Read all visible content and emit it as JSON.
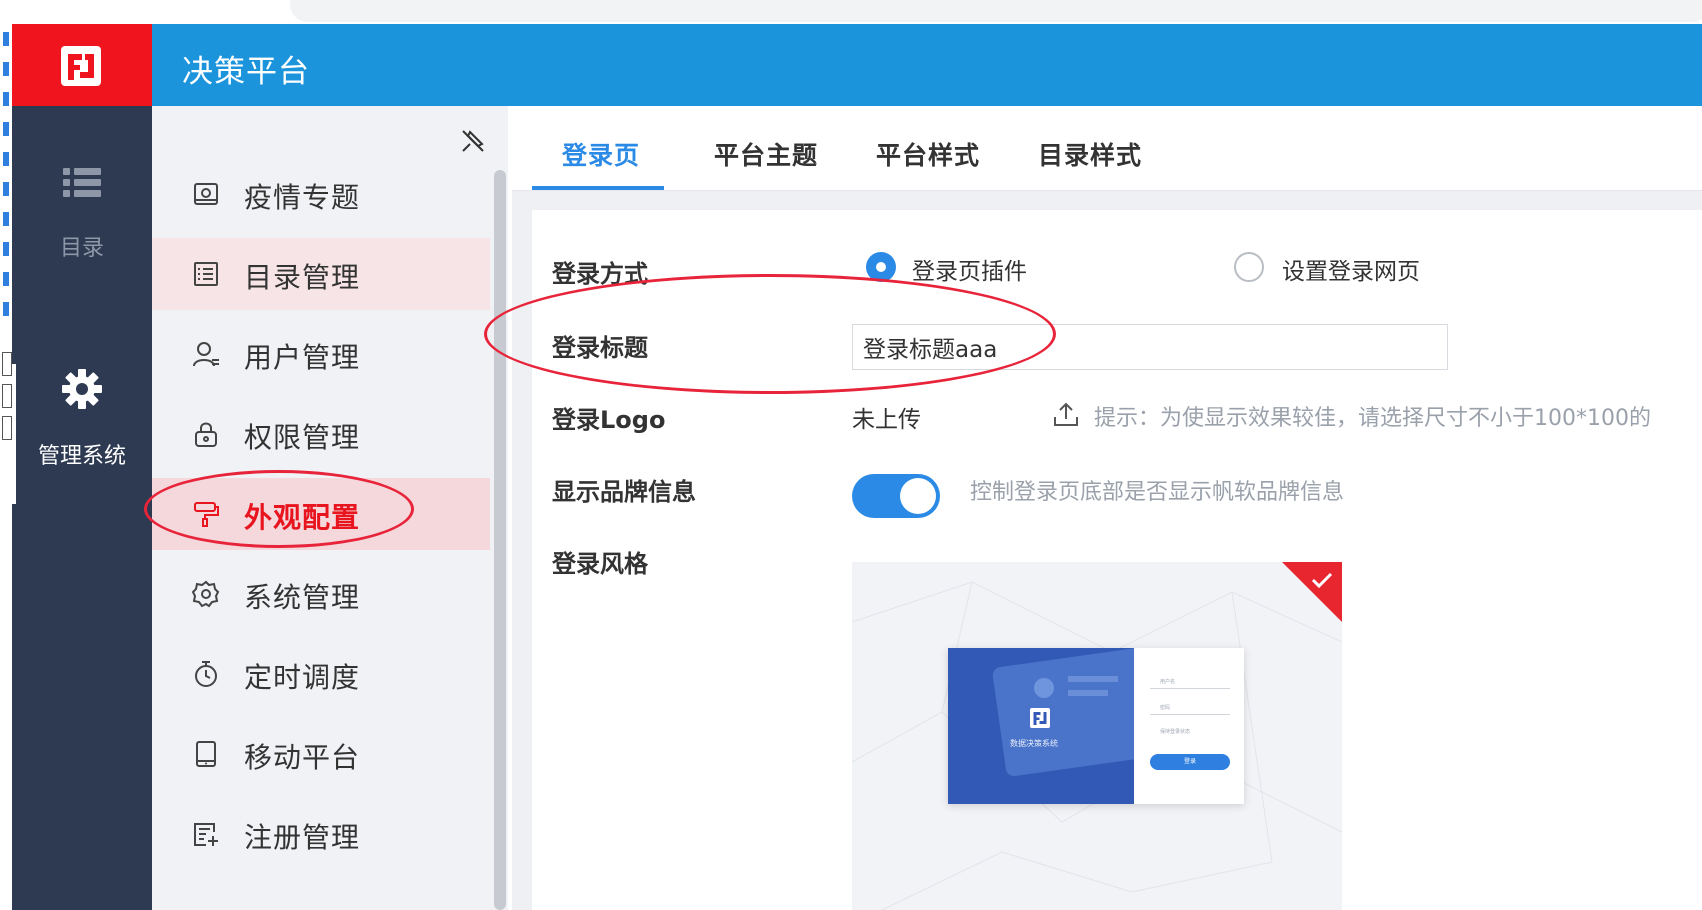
{
  "app": {
    "title": "决策平台"
  },
  "icon_sidebar": {
    "items": [
      {
        "label": "目录",
        "icon": "list-icon"
      },
      {
        "label": "管理系统",
        "icon": "gear-icon"
      }
    ]
  },
  "menu": {
    "items": [
      {
        "label": "疫情专题",
        "icon": "dashboard-icon"
      },
      {
        "label": "目录管理",
        "icon": "directory-icon"
      },
      {
        "label": "用户管理",
        "icon": "user-icon"
      },
      {
        "label": "权限管理",
        "icon": "lock-icon"
      },
      {
        "label": "外观配置",
        "icon": "paint-roller-icon"
      },
      {
        "label": "系统管理",
        "icon": "gear-outline-icon"
      },
      {
        "label": "定时调度",
        "icon": "stopwatch-icon"
      },
      {
        "label": "移动平台",
        "icon": "tablet-icon"
      },
      {
        "label": "注册管理",
        "icon": "register-icon"
      }
    ],
    "selected_index": 4
  },
  "tabs": [
    "登录页",
    "平台主题",
    "平台样式",
    "目录样式"
  ],
  "active_tab": 0,
  "form": {
    "login_method": {
      "label": "登录方式",
      "options": [
        "登录页插件",
        "设置登录网页"
      ],
      "selected": 0
    },
    "login_title": {
      "label": "登录标题",
      "value": "登录标题aaa"
    },
    "login_logo": {
      "label": "登录Logo",
      "status": "未上传",
      "hint": "提示：为使显示效果较佳，请选择尺寸不小于100*100的"
    },
    "show_brand": {
      "label": "显示品牌信息",
      "enabled": true,
      "hint": "控制登录页底部是否显示帆软品牌信息"
    },
    "login_style": {
      "label": "登录风格",
      "preview_brand": "数据决策系统",
      "preview_username_placeholder": "用户名",
      "preview_password_placeholder": "密码",
      "preview_remember": "保持登录状态",
      "preview_login_button": "登录"
    }
  },
  "colors": {
    "brand_red": "#f0141e",
    "header_blue": "#1b94dc",
    "sidebar_dark": "#2e3a52",
    "accent_blue": "#2a8ae6",
    "annotation_red": "#e8243a"
  }
}
